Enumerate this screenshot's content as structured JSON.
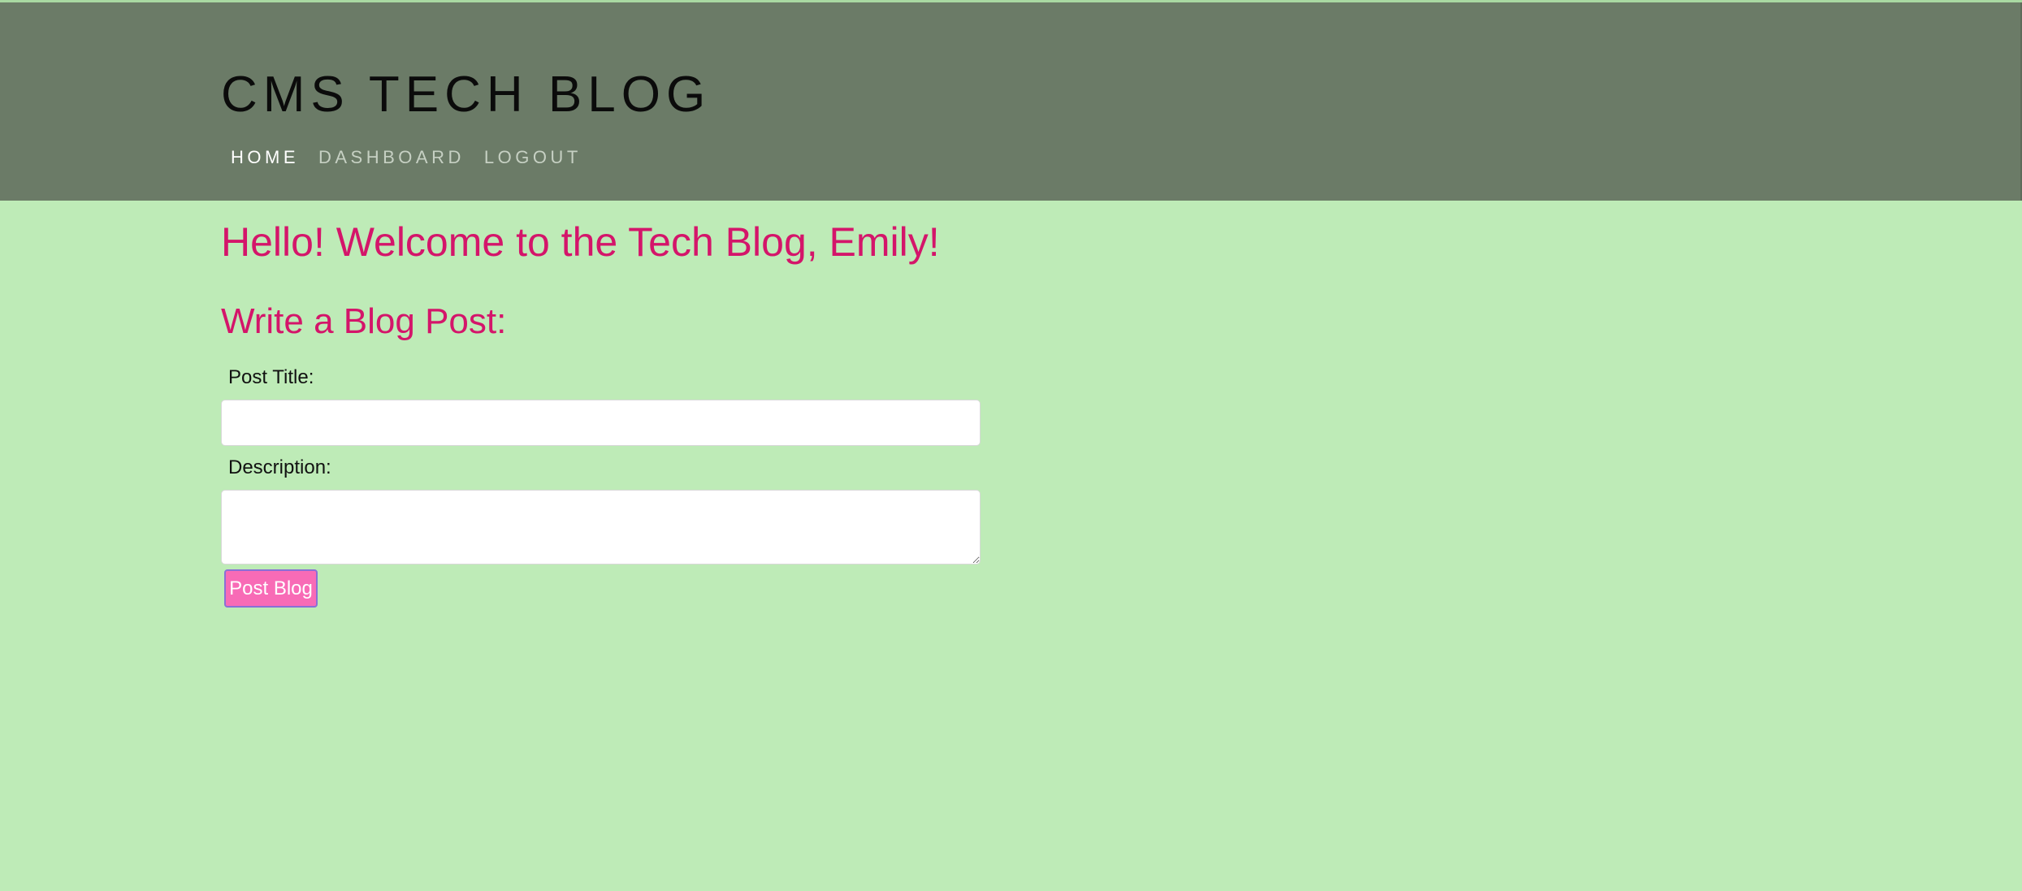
{
  "header": {
    "title": "CMS TECH BLOG",
    "background_color": "#6b7b67"
  },
  "nav": {
    "items": [
      {
        "label": "HOME",
        "active": true
      },
      {
        "label": "DASHBOARD",
        "active": false
      },
      {
        "label": "LOGOUT",
        "active": false
      }
    ]
  },
  "main": {
    "welcome": "Hello! Welcome to the Tech Blog, Emily!",
    "form": {
      "heading": "Write a Blog Post:",
      "title_label": "Post Title:",
      "title_value": "",
      "description_label": "Description:",
      "description_value": "",
      "submit_label": "Post Blog"
    }
  },
  "colors": {
    "page_background": "#beebb7",
    "accent_text": "#d4156a",
    "button_background": "#f86bb6",
    "button_border": "#8a6fd6"
  }
}
